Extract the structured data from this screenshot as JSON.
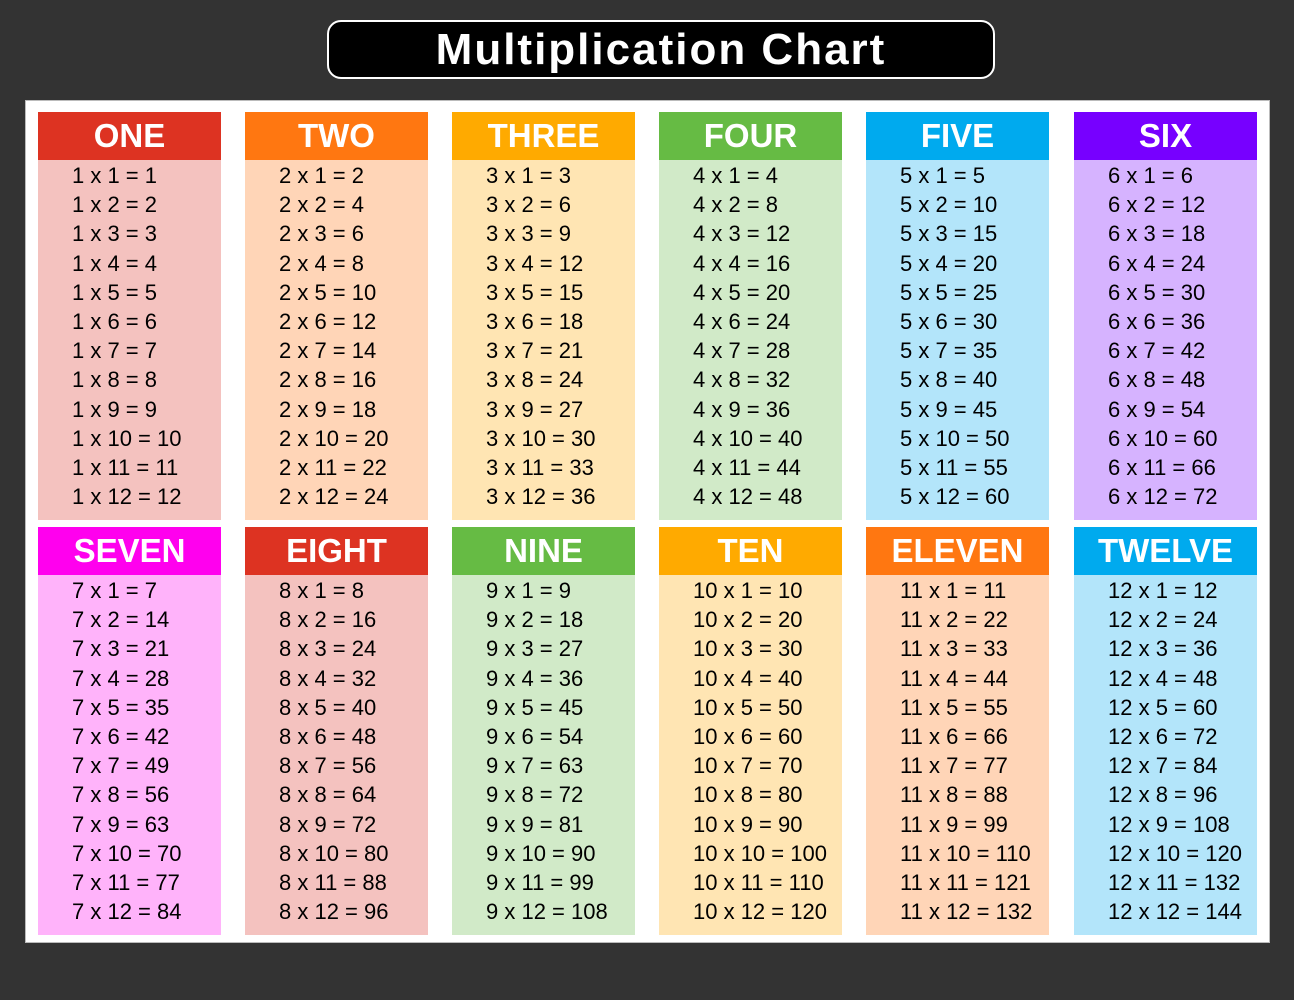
{
  "title": "Multiplication Chart",
  "tables": [
    {
      "label": "ONE",
      "n": 1,
      "header_color": "#dd3322",
      "body_color": "#f4c2bf",
      "rows": [
        "1 x 1 = 1",
        "1 x 2 = 2",
        "1 x 3 = 3",
        "1 x 4 = 4",
        "1 x 5 = 5",
        "1 x 6 = 6",
        "1 x 7 = 7",
        "1 x 8 = 8",
        "1 x 9 = 9",
        "1 x 10 = 10",
        "1 x 11 = 11",
        "1 x 12 = 12"
      ]
    },
    {
      "label": "TWO",
      "n": 2,
      "header_color": "#ff7711",
      "body_color": "#ffd5b7",
      "rows": [
        "2 x 1 = 2",
        "2 x 2 = 4",
        "2 x 3 = 6",
        "2 x 4 = 8",
        "2 x 5 = 10",
        "2 x 6 = 12",
        "2 x 7 = 14",
        "2 x 8 = 16",
        "2 x 9 = 18",
        "2 x 10 = 20",
        "2 x 11 = 22",
        "2 x 12 = 24"
      ]
    },
    {
      "label": "THREE",
      "n": 3,
      "header_color": "#ffaa00",
      "body_color": "#ffe5b3",
      "rows": [
        "3 x 1 = 3",
        "3 x 2 = 6",
        "3 x 3 = 9",
        "3 x 4 = 12",
        "3 x 5 = 15",
        "3 x 6 = 18",
        "3 x 7 = 21",
        "3 x 8 = 24",
        "3 x 9 = 27",
        "3 x 10 = 30",
        "3 x 11 = 33",
        "3 x 12 = 36"
      ]
    },
    {
      "label": "FOUR",
      "n": 4,
      "header_color": "#66bb44",
      "body_color": "#d1eac8",
      "rows": [
        "4 x 1 = 4",
        "4 x 2 = 8",
        "4 x 3 = 12",
        "4 x 4 = 16",
        "4 x 5 = 20",
        "4 x 6 = 24",
        "4 x 7 = 28",
        "4 x 8 = 32",
        "4 x 9 = 36",
        "4 x 10 = 40",
        "4 x 11 = 44",
        "4 x 12 = 48"
      ]
    },
    {
      "label": "FIVE",
      "n": 5,
      "header_color": "#00aaee",
      "body_color": "#b3e5fa",
      "rows": [
        "5 x 1 = 5",
        "5 x 2 = 10",
        "5 x 3 = 15",
        "5 x 4 = 20",
        "5 x 5 = 25",
        "5 x 6 = 30",
        "5 x 7 = 35",
        "5 x 8 = 40",
        "5 x 9 = 45",
        "5 x 10 = 50",
        "5 x 11 = 55",
        "5 x 12 = 60"
      ]
    },
    {
      "label": "SIX",
      "n": 6,
      "header_color": "#7700ff",
      "body_color": "#d6b3ff",
      "rows": [
        "6 x 1 = 6",
        "6 x 2 = 12",
        "6 x 3 = 18",
        "6 x 4 = 24",
        "6 x 5 = 30",
        "6 x 6 = 36",
        "6 x 7 = 42",
        "6 x 8 = 48",
        "6 x 9 = 54",
        "6 x 10 = 60",
        "6 x 11 = 66",
        "6 x 12 = 72"
      ]
    },
    {
      "label": "SEVEN",
      "n": 7,
      "header_color": "#ff00ee",
      "body_color": "#ffb3fa",
      "rows": [
        "7 x 1 = 7",
        "7 x 2 = 14",
        "7 x 3 = 21",
        "7 x 4 = 28",
        "7 x 5 = 35",
        "7 x 6 = 42",
        "7 x 7 = 49",
        "7 x 8 = 56",
        "7 x 9 = 63",
        "7 x 10 = 70",
        "7 x 11 = 77",
        "7 x 12 = 84"
      ]
    },
    {
      "label": "EIGHT",
      "n": 8,
      "header_color": "#dd3322",
      "body_color": "#f4c2bf",
      "rows": [
        "8 x 1 = 8",
        "8 x 2 = 16",
        "8 x 3 = 24",
        "8 x 4 = 32",
        "8 x 5 = 40",
        "8 x 6 = 48",
        "8 x 7 = 56",
        "8 x 8 = 64",
        "8 x 9 = 72",
        "8 x 10 = 80",
        "8 x 11 = 88",
        "8 x 12 = 96"
      ]
    },
    {
      "label": "NINE",
      "n": 9,
      "header_color": "#66bb44",
      "body_color": "#d1eac8",
      "rows": [
        "9 x 1 = 9",
        "9 x 2 = 18",
        "9 x 3 = 27",
        "9 x 4 = 36",
        "9 x 5 = 45",
        "9 x 6 = 54",
        "9 x 7 = 63",
        "9 x 8 = 72",
        "9 x 9 = 81",
        "9 x 10 = 90",
        "9 x 11 = 99",
        "9 x 12 = 108"
      ]
    },
    {
      "label": "TEN",
      "n": 10,
      "header_color": "#ffaa00",
      "body_color": "#ffe5b3",
      "rows": [
        "10 x 1 = 10",
        "10 x 2 = 20",
        "10 x 3 = 30",
        "10 x 4 = 40",
        "10 x 5 = 50",
        "10 x 6 = 60",
        "10 x 7 = 70",
        "10 x 8 = 80",
        "10 x 9 = 90",
        "10 x 10 = 100",
        "10 x 11 = 110",
        "10 x 12 = 120"
      ]
    },
    {
      "label": "ELEVEN",
      "n": 11,
      "header_color": "#ff7711",
      "body_color": "#ffd5b7",
      "rows": [
        "11 x 1 = 11",
        "11 x 2 = 22",
        "11 x 3 = 33",
        "11 x 4 = 44",
        "11 x 5 = 55",
        "11 x 6 = 66",
        "11 x 7 = 77",
        "11 x 8 = 88",
        "11 x 9 = 99",
        "11 x 10 = 110",
        "11 x 11 = 121",
        "11 x 12 = 132"
      ]
    },
    {
      "label": "TWELVE",
      "n": 12,
      "header_color": "#00aaee",
      "body_color": "#b3e5fa",
      "rows": [
        "12 x 1 = 12",
        "12 x 2 = 24",
        "12 x 3 = 36",
        "12 x 4 = 48",
        "12 x 5 = 60",
        "12 x 6 = 72",
        "12 x 7 = 84",
        "12 x 8 = 96",
        "12 x 9 = 108",
        "12 x 10 = 120",
        "12 x 11 = 132",
        "12 x 12 = 144"
      ]
    }
  ]
}
